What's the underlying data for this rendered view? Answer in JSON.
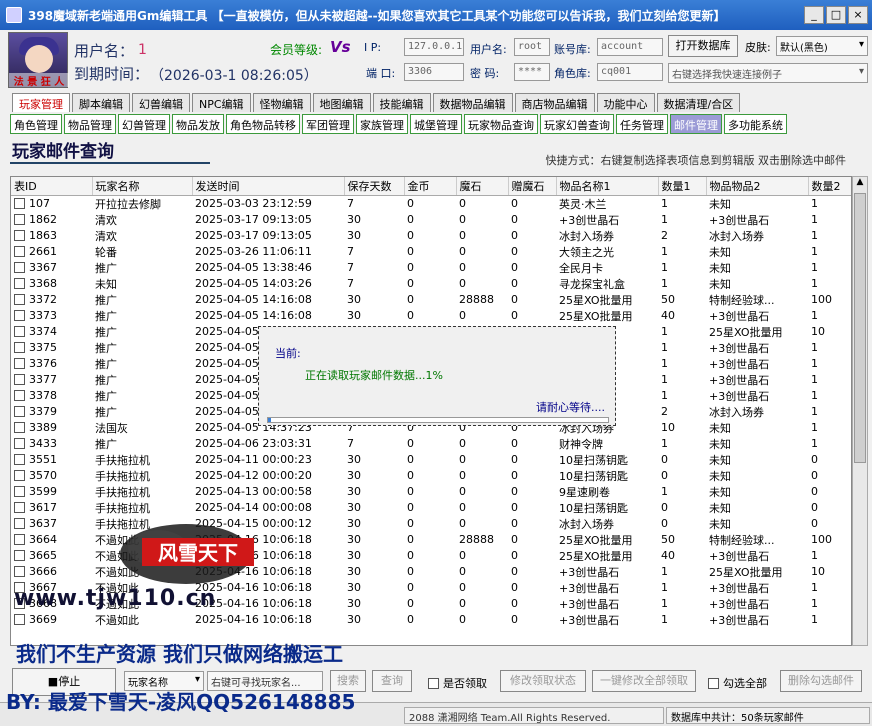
{
  "title": "398魔域新老端通用Gm编辑工具 【一直被模仿，但从未被超越--如果您喜欢其它工具某个功能您可以告诉我，我们立刻给您更新】",
  "window_buttons": [
    "_",
    "□",
    "×"
  ],
  "avatar_stamp": "法 景 狂 人",
  "header": {
    "username_label": "用户名：",
    "username_value": "1",
    "expiry_label": "到期时间：",
    "expiry_value": "（2026-03-1 08:26:05）",
    "member_label": "会员等级:",
    "member_value": "Vs",
    "ip_label": "I P:",
    "ip_value": "127.0.0.1",
    "port_label": "端 口:",
    "port_value": "3306",
    "user_label": "用户名:",
    "user_value": "root",
    "pwd_label": "密 码:",
    "pwd_value": "****",
    "account_db_label": "账号库:",
    "account_db_value": "account",
    "role_db_label": "角色库:",
    "role_db_value": "cq001",
    "open_db_button": "打开数据库",
    "skin_label": "皮肤:",
    "skin_value": "默认(黑色)",
    "quick_connect_placeholder": "右键选择我快速连接例子"
  },
  "main_tabs": [
    "玩家管理",
    "脚本编辑",
    "幻兽编辑",
    "NPC编辑",
    "怪物编辑",
    "地图编辑",
    "技能编辑",
    "数据物品编辑",
    "商店物品编辑",
    "功能中心",
    "数据清理/合区"
  ],
  "sub_tabs": [
    "角色管理",
    "物品管理",
    "幻兽管理",
    "物品发放",
    "角色物品转移",
    "军团管理",
    "家族管理",
    "城堡管理",
    "玩家物品查询",
    "玩家幻兽查询",
    "任务管理",
    "邮件管理",
    "多功能系统"
  ],
  "section_title": "玩家邮件查询",
  "hint": "快捷方式：右键复制选择表项信息到剪辑版 双击删除选中邮件",
  "table": {
    "columns": [
      "表ID",
      "玩家名称",
      "发送时间",
      "保存天数",
      "金币",
      "魔石",
      "赠魔石",
      "物品名称1",
      "数量1",
      "物品物品2",
      "数量2"
    ],
    "rows": [
      [
        "107",
        "开拉拉去修脚",
        "2025-03-03 23:12:59",
        "7",
        "0",
        "0",
        "0",
        "英灵·木兰",
        "1",
        "未知",
        "1"
      ],
      [
        "1862",
        "清欢",
        "2025-03-17 09:13:05",
        "30",
        "0",
        "0",
        "0",
        "+3创世晶石",
        "1",
        "+3创世晶石",
        "1"
      ],
      [
        "1863",
        "清欢",
        "2025-03-17 09:13:05",
        "30",
        "0",
        "0",
        "0",
        "冰封入场券",
        "2",
        "冰封入场券",
        "1"
      ],
      [
        "2661",
        "轮番",
        "2025-03-26 11:06:11",
        "7",
        "0",
        "0",
        "0",
        "大领主之光",
        "1",
        "未知",
        "1"
      ],
      [
        "3367",
        "推广",
        "2025-04-05 13:38:46",
        "7",
        "0",
        "0",
        "0",
        "全民月卡",
        "1",
        "未知",
        "1"
      ],
      [
        "3368",
        "未知",
        "2025-04-05 14:03:26",
        "7",
        "0",
        "0",
        "0",
        "寻龙探宝礼盒",
        "1",
        "未知",
        "1"
      ],
      [
        "3372",
        "推广",
        "2025-04-05 14:16:08",
        "30",
        "0",
        "28888",
        "0",
        "25星XO批量用",
        "50",
        "特制经验球...",
        "100"
      ],
      [
        "3373",
        "推广",
        "2025-04-05 14:16:08",
        "30",
        "0",
        "0",
        "0",
        "25星XO批量用",
        "40",
        "+3创世晶石",
        "1"
      ],
      [
        "3374",
        "推广",
        "2025-04-05",
        "",
        "",
        "",
        "",
        "",
        "1",
        "25星XO批量用",
        "10"
      ],
      [
        "3375",
        "推广",
        "2025-04-05",
        "",
        "",
        "",
        "",
        "",
        "1",
        "+3创世晶石",
        "1"
      ],
      [
        "3376",
        "推广",
        "2025-04-05",
        "",
        "",
        "",
        "",
        "",
        "1",
        "+3创世晶石",
        "1"
      ],
      [
        "3377",
        "推广",
        "2025-04-05",
        "",
        "",
        "",
        "",
        "",
        "1",
        "+3创世晶石",
        "1"
      ],
      [
        "3378",
        "推广",
        "2025-04-05",
        "",
        "",
        "",
        "",
        "",
        "1",
        "+3创世晶石",
        "1"
      ],
      [
        "3379",
        "推广",
        "2025-04-05",
        "",
        "",
        "",
        "",
        "",
        "2",
        "冰封入场券",
        "1"
      ],
      [
        "3389",
        "法国灰",
        "2025-04-05 14:37:23",
        "7",
        "0",
        "0",
        "0",
        "冰封入场券",
        "10",
        "未知",
        "1"
      ],
      [
        "3433",
        "推广",
        "2025-04-06 23:03:31",
        "7",
        "0",
        "0",
        "0",
        "财神令牌",
        "1",
        "未知",
        "1"
      ],
      [
        "3551",
        "手扶拖拉机",
        "2025-04-11 00:00:23",
        "30",
        "0",
        "0",
        "0",
        "10星扫荡钥匙",
        "0",
        "未知",
        "0"
      ],
      [
        "3570",
        "手扶拖拉机",
        "2025-04-12 00:00:20",
        "30",
        "0",
        "0",
        "0",
        "10星扫荡钥匙",
        "0",
        "未知",
        "0"
      ],
      [
        "3599",
        "手扶拖拉机",
        "2025-04-13 00:00:58",
        "30",
        "0",
        "0",
        "0",
        "9星速刷卷",
        "1",
        "未知",
        "0"
      ],
      [
        "3617",
        "手扶拖拉机",
        "2025-04-14 00:00:08",
        "30",
        "0",
        "0",
        "0",
        "10星扫荡钥匙",
        "0",
        "未知",
        "0"
      ],
      [
        "3637",
        "手扶拖拉机",
        "2025-04-15 00:00:12",
        "30",
        "0",
        "0",
        "0",
        "冰封入场券",
        "0",
        "未知",
        "0"
      ],
      [
        "3664",
        "不過如此",
        "2025-04-16 10:06:18",
        "30",
        "0",
        "28888",
        "0",
        "25星XO批量用",
        "50",
        "特制经验球...",
        "100"
      ],
      [
        "3665",
        "不過如此",
        "2025-04-16 10:06:18",
        "30",
        "0",
        "0",
        "0",
        "25星XO批量用",
        "40",
        "+3创世晶石",
        "1"
      ],
      [
        "3666",
        "不過如此",
        "2025-04-16 10:06:18",
        "30",
        "0",
        "0",
        "0",
        "+3创世晶石",
        "1",
        "25星XO批量用",
        "10"
      ],
      [
        "3667",
        "不過如此",
        "2025-04-16 10:06:18",
        "30",
        "0",
        "0",
        "0",
        "+3创世晶石",
        "1",
        "+3创世晶石",
        "1"
      ],
      [
        "3668",
        "不過如此",
        "2025-04-16 10:06:18",
        "30",
        "0",
        "0",
        "0",
        "+3创世晶石",
        "1",
        "+3创世晶石",
        "1"
      ],
      [
        "3669",
        "不過如此",
        "2025-04-16 10:06:18",
        "30",
        "0",
        "0",
        "0",
        "+3创世晶石",
        "1",
        "+3创世晶石",
        "1"
      ]
    ]
  },
  "loading_dialog": {
    "label": "当前:",
    "message": "正在读取玩家邮件数据...1%",
    "wait": "请耐心等待....",
    "progress_percent": 1
  },
  "watermark": {
    "logo_text": "风雪天下",
    "url": "www.tjw110.cn",
    "slogan": "我们不生产资源 我们只做网络搬运工",
    "by": "BY: 最爱下雪天-凌风QQ526148885"
  },
  "bottom": {
    "stop_button": "■停止",
    "filter_select": "玩家名称",
    "filter_input": "右键可寻找玩家名...",
    "search_button": "搜索",
    "query_button": "查询",
    "claimed_checkbox": "是否领取",
    "modify_claim_button": "修改领取状态",
    "modify_all_button": "一键修改全部领取",
    "select_all_checkbox": "勾选全部",
    "delete_checked_button": "删除勾选邮件"
  },
  "status": {
    "copyright": "2088 潇湘网络 Team.All Rights Reserved.",
    "count": "数据库中共计：50条玩家邮件"
  },
  "colors": {
    "titlebar": "#1f5fbf",
    "accent_tab": "#c00000",
    "sub_tab_border": "#3c9a3c"
  }
}
